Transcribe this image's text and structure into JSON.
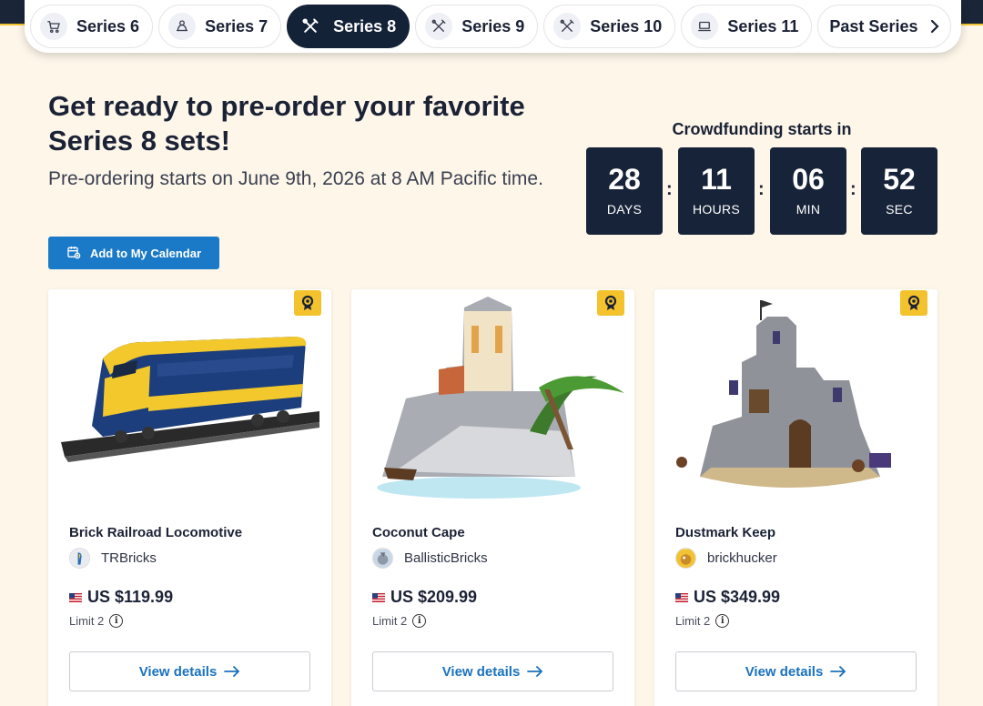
{
  "nav": {
    "tabs": [
      {
        "label": "Series 6",
        "icon": "cart-icon",
        "active": false
      },
      {
        "label": "Series 7",
        "icon": "tower-icon",
        "active": false
      },
      {
        "label": "Series 8",
        "icon": "tools-icon",
        "active": true
      },
      {
        "label": "Series 9",
        "icon": "tools-icon",
        "active": false
      },
      {
        "label": "Series 10",
        "icon": "tools-icon",
        "active": false
      },
      {
        "label": "Series 11",
        "icon": "laptop-icon",
        "active": false
      }
    ],
    "past_label": "Past Series"
  },
  "hero": {
    "headline": "Get ready to pre-order your favorite Series 8 sets!",
    "subline": "Pre-ordering starts on June 9th, 2026 at 8 AM Pacific time.",
    "calendar_button": "Add to My Calendar"
  },
  "countdown": {
    "title": "Crowdfunding starts in",
    "days": "28",
    "days_label": "DAYS",
    "hours": "11",
    "hours_label": "HOURS",
    "minutes": "06",
    "minutes_label": "MIN",
    "seconds": "52",
    "seconds_label": "SEC",
    "separator": ":"
  },
  "products": [
    {
      "name": "Brick Railroad Locomotive",
      "creator": "TRBricks",
      "price": "US $119.99",
      "limit": "Limit 2",
      "button": "View details"
    },
    {
      "name": "Coconut Cape",
      "creator": "BallisticBricks",
      "price": "US $209.99",
      "limit": "Limit 2",
      "button": "View details"
    },
    {
      "name": "Dustmark Keep",
      "creator": "brickhucker",
      "price": "US $349.99",
      "limit": "Limit 2",
      "button": "View details"
    }
  ],
  "colors": {
    "navy": "#142238",
    "accent_blue": "#1a7ac8",
    "badge_yellow": "#f3c22d",
    "background": "#fdf6e9"
  }
}
